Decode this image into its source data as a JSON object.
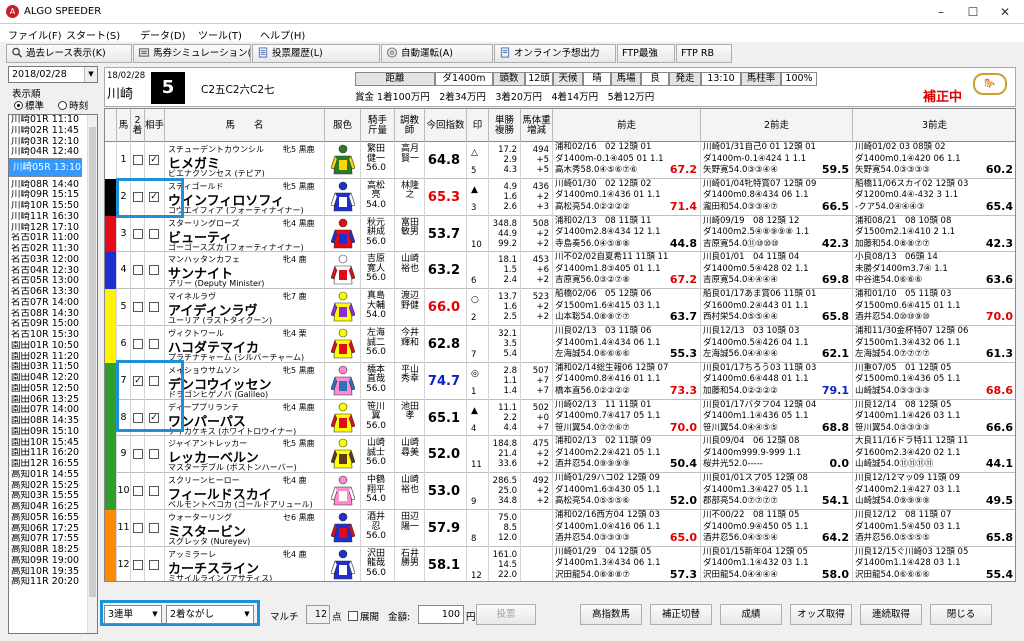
{
  "app": {
    "title": "ALGO SPEEDER",
    "icon": "algo-logo-icon"
  },
  "window": {
    "minimize": "–",
    "maximize": "☐",
    "close": "✕"
  },
  "menu": [
    "ファイル(F)",
    "スタート(S)",
    "データ(D)",
    "ツール(T)",
    "ヘルプ(H)"
  ],
  "toolbar": [
    {
      "label": "過去レース表示(K)",
      "icon": "search-icon"
    },
    {
      "label": "馬券シミュレーション(B)",
      "icon": "ticket-icon"
    },
    {
      "label": "投票履歴(L)",
      "icon": "document-icon"
    },
    {
      "label": "自動運転(A)",
      "icon": "disc-icon"
    },
    {
      "label": "オンライン予想出力",
      "icon": "document-icon"
    },
    {
      "label": "FTP最強",
      "icon": ""
    },
    {
      "label": "FTP RB",
      "icon": ""
    }
  ],
  "left": {
    "date": "2018/02/28",
    "order_label": "表示順",
    "order_opts": [
      "標準",
      "時刻"
    ],
    "races": [
      "川崎01R 11:10",
      "川崎02R 11:45",
      "川崎03R 12:10",
      "川崎04R 12:40",
      "川崎05R 13:10",
      "川崎06R 13:40",
      "川崎07R 14:10",
      "川崎08R 14:40",
      "川崎09R 15:15",
      "川崎10R 15:50",
      "川崎11R 16:30",
      "川崎12R 17:10",
      "名古01R 11:00",
      "名古02R 11:30",
      "名古03R 12:00",
      "名古04R 12:30",
      "名古05R 13:00",
      "名古06R 13:30",
      "名古07R 14:00",
      "名古08R 14:30",
      "名古09R 15:00",
      "名古10R 15:30",
      "園田01R 10:50",
      "園田02R 11:20",
      "園田03R 11:50",
      "園田04R 12:20",
      "園田05R 12:50",
      "園田06R 13:25",
      "園田07R 14:00",
      "園田08R 14:35",
      "園田09R 15:10",
      "園田10R 15:45",
      "園田11R 16:20",
      "園田12R 16:55",
      "高知01R 14:55",
      "高知02R 15:25",
      "高知03R 15:55",
      "高知04R 16:25",
      "高知05R 16:55",
      "高知06R 17:25",
      "高知07R 17:55",
      "高知08R 18:25",
      "高知09R 19:00",
      "高知10R 19:35",
      "高知11R 20:20"
    ],
    "selected": 4
  },
  "race": {
    "date": "18/02/28",
    "venue": "川崎",
    "number": "5",
    "class": "C2五C2六C2七",
    "dist_lbl": "距離",
    "dist": "ダ1400m",
    "count_lbl": "頭数",
    "count": "12頭",
    "weather_lbl": "天候",
    "weather": "晴",
    "track_lbl": "馬場",
    "track": "良",
    "post_lbl": "発走",
    "post": "13:10",
    "rate_lbl": "馬柱率",
    "rate": "100%",
    "prize": "賞金 1着100万円　2着34万円　3着20万円　4着14万円　5着12万円",
    "correction": "補正中"
  },
  "headers": [
    "馬",
    "2着",
    "相手",
    "馬　　名",
    "服色",
    "騎手\n斤量",
    "調教\n師",
    "今回指数",
    "印",
    "単勝\n複勝",
    "馬体重\n増減",
    "前走",
    "2前走",
    "3前走"
  ],
  "frame_colors": [
    "#ffffff",
    "#000000",
    "#e30b16",
    "#1e2fd0",
    "#fff200",
    "#2e9e2e",
    "#2e9e2e",
    "#ff8c00",
    "#ff8c00",
    "#ff8cd0",
    "#ff8cd0"
  ],
  "horses": [
    {
      "no": "1",
      "frame": "1",
      "c2": false,
      "opp": true,
      "sire": "スチューデントカウンシル",
      "sex": "牝5 黒鹿",
      "name": "ヒメガミ",
      "dam": "ビエナクソンセス (テピア)",
      "silk": [
        "#2a7a2a",
        "#ffd700"
      ],
      "jockey": "繁田\n健一\n56.0",
      "trainer": "高月\n賢一",
      "index": "64.8",
      "idx_color": "",
      "mark": "△",
      "mark_n": "5",
      "odds": "17.2\n2.9\n4.3",
      "weight": "494\n+5\n+5",
      "p1": [
        "浦和02/16　02 12頭 01",
        "ダ1400m-0.1④405 01 1.1",
        "高木秀58.0④⑤⑥⑦⑥ 67.2"
      ],
      "p1i": "67.2",
      "p1red": true,
      "p2": [
        "川崎01/31自己0 01 12頭 01",
        "ダ1400m-0.1④424 1 1.1",
        "矢野寛54.0③③④④ 59.5"
      ],
      "p2i": "59.5",
      "p3": [
        "川崎01/02 03 08頭 02",
        "ダ1400m0.1④420 06 1.1",
        "矢野寛54.0③③③③ 60.2"
      ],
      "p3i": "60.2"
    },
    {
      "no": "2",
      "frame": "2",
      "c2": false,
      "opp": true,
      "sire": "スティゴールド",
      "sex": "牝5 黒鹿",
      "name": "ウインフィロソフィ",
      "dam": "コウエイフィア (フォーティナイナー)",
      "silk": [
        "#1e2fd0",
        "#ffffff"
      ],
      "jockey": "高松\n亮\n54.0",
      "trainer": "林隆\n之",
      "index": "65.3",
      "idx_color": "red",
      "mark": "▲",
      "mark_n": "3",
      "odds": "4.9\n1.6\n2.6",
      "weight": "436\n+2\n+3",
      "p1": [
        "川崎01/30　02 12頭 02",
        "ダ1400m0.1④436 01 1.1",
        "高松亮54.0②②②② 71.4"
      ],
      "p1i": "71.4",
      "p1red": true,
      "p2": [
        "川崎01/04牝特賞07 12頭 09",
        "ダ1400m0.8④434 06 1.1",
        "瀧田和54.0③③④⑦ 66.5"
      ],
      "p2i": "66.5",
      "p3": [
        "船橋11/06スカイ02 12頭 03",
        "ダ1200m0.4④-432 3 1.1",
        "-クア54.0④④④③ 65.4"
      ],
      "p3i": "65.4"
    },
    {
      "no": "3",
      "frame": "3",
      "c2": false,
      "opp": false,
      "sire": "スターリングローズ",
      "sex": "牝4 黒鹿",
      "name": "ビューティ",
      "dam": "ゴーゴースズカ (フォーティナイナー)",
      "silk": [
        "#e30b16",
        "#1e2fd0"
      ],
      "jockey": "秋元\n耕成\n56.0",
      "trainer": "富田\n敏男",
      "index": "53.7",
      "idx_color": "",
      "mark": "",
      "mark_n": "10",
      "odds": "348.8\n44.9\n99.2",
      "weight": "508\n+2\n+2",
      "p1": [
        "浦和02/13　08 11頭 11",
        "ダ1400m2.8④434 12 1.1",
        "寺島奏56.0④⑤⑧⑧ 44.8"
      ],
      "p1i": "44.8",
      "p2": [
        "川崎09/19　08 12頭 12",
        "ダ1400m2.5④⑧⑨⑨⑧ 1.1",
        "吉原寛54.0⑪⑩⑩⑩ 42.3"
      ],
      "p2i": "42.3",
      "p3": [
        "浦和08/21　08 10頭 08",
        "ダ1500m2.1④410 2 1.1",
        "加藤和54.0⑧⑧⑦⑦ 42.3"
      ],
      "p3i": "42.3"
    },
    {
      "no": "4",
      "frame": "4",
      "c2": false,
      "opp": false,
      "sire": "マンハッタンカフェ",
      "sex": "牝4 鹿",
      "name": "サンナイト",
      "dam": "アリー (Deputy Minister)",
      "silk": [
        "#ffffff",
        "#e30b16"
      ],
      "jockey": "吉原\n寛人\n56.0",
      "trainer": "山崎\n裕也",
      "index": "63.2",
      "idx_color": "",
      "mark": "",
      "mark_n": "6",
      "odds": "18.1\n1.5\n2.4",
      "weight": "453\n+6\n+2",
      "p1": [
        "川不02/02自夏希11 11頭 11",
        "ダ1400m1.8③405 01 1.1",
        "吉原寛56.0③②⑦⑧ 67.2"
      ],
      "p1i": "67.2",
      "p1red": true,
      "p2": [
        "川良01/01　04 11頭 04",
        "ダ1400m0.5④428 02 1.1",
        "吉原寛54.0④④④④ 69.8"
      ],
      "p2i": "69.8",
      "p3": [
        "小良08/13　06頭 14",
        "未勝ダ1400m3.7④ 1.1",
        "中谷進54.0⑥⑥⑥ 63.6"
      ],
      "p3i": "63.6"
    },
    {
      "no": "5",
      "frame": "5",
      "c2": false,
      "opp": false,
      "sire": "マイネルラヴ",
      "sex": "牝7 鹿",
      "name": "アイディンラヴ",
      "dam": "ユーリア (ラストタイクーン)",
      "silk": [
        "#ffff00",
        "#8a2be2"
      ],
      "jockey": "真島\n大輔\n54.0",
      "trainer": "渡辺\n野健",
      "index": "66.0",
      "idx_color": "red",
      "mark": "○",
      "mark_n": "2",
      "odds": "13.7\n1.6\n2.5",
      "weight": "523\n+2\n+2",
      "p1": [
        "船橋02/06　05 12頭 06",
        "ダ1500m1.6④415 03 1.1",
        "山本聡54.0⑧⑧⑦⑦ 63.7"
      ],
      "p1i": "63.7",
      "p2": [
        "船良01/17あま賞06 11頭 01",
        "ダ1600m0.2④443 01 1.1",
        "西村栄54.0⑤⑤④④ 65.8"
      ],
      "p2i": "65.8",
      "p3": [
        "浦和01/10　05 11頭 03",
        "ダ1500m0.6④415 01 1.1",
        "酒井忍54.0⑩⑩⑨⑩ 70.0"
      ],
      "p3i": "70.0",
      "p3red": true
    },
    {
      "no": "6",
      "frame": "5",
      "c2": false,
      "opp": false,
      "sire": "ヴィクトワール",
      "sex": "牝4 栗",
      "name": "ハコダテマイカ",
      "dam": "プラチナチャーム (シルバーチャーム)",
      "silk": [
        "#ffff00",
        "#e30b16"
      ],
      "jockey": "左海\n誠二\n56.0",
      "trainer": "今井\n輝和",
      "index": "62.8",
      "idx_color": "",
      "mark": "",
      "mark_n": "7",
      "odds": "32.1\n3.5\n5.4",
      "weight": "",
      "p1": [
        "川良02/13　03 11頭 06",
        "ダ1400m1.4④434 06 1.1",
        "左海誠54.0⑥⑥⑥⑥ 55.3"
      ],
      "p1i": "55.3",
      "p2": [
        "川良12/13　03 10頭 03",
        "ダ1400m0.5④426 04 1.1",
        "左海誠56.0④④④④ 62.1"
      ],
      "p2i": "62.1",
      "p3": [
        "浦和11/30金杯特07 12頭 06",
        "ダ1500m1.3④432 06 1.1",
        "左海誠54.0⑦⑦⑦⑦ 61.3"
      ],
      "p3i": "61.3"
    },
    {
      "no": "7",
      "frame": "6",
      "c2": true,
      "opp": false,
      "sire": "メイショウサムソン",
      "sex": "牝5 黒鹿",
      "name": "デンコウイッセン",
      "dam": "ドラゴンヒゲノバ (Galileo)",
      "silk": [
        "#ff8cd0",
        "#3070c0"
      ],
      "jockey": "橋本\n直哉\n56.0",
      "trainer": "平山\n秀幸",
      "index": "74.7",
      "idx_color": "blue",
      "mark": "◎",
      "mark_n": "1",
      "odds": "2.8\n1.1\n1.4",
      "weight": "507\n+7\n+7",
      "p1": [
        "浦和02/14総生報06 12頭 07",
        "ダ1400m0.8④416 01 1.1",
        "橋本直56.0②②②② 73.3"
      ],
      "p1i": "73.3",
      "p1red": true,
      "p2": [
        "川良01/17ちろう03 11頭 03",
        "ダ1400m0.6④448 01 1.1",
        "加藤和54.0②②②② 79.1"
      ],
      "p2i": "79.1",
      "p2blue": true,
      "p3": [
        "川重07/05　01 12頭 05",
        "ダ1500m0.1④436 05 1.1",
        "山崎誠54.0③③③③ 68.6"
      ],
      "p3i": "68.6",
      "p3red": true
    },
    {
      "no": "8",
      "frame": "6",
      "c2": false,
      "opp": true,
      "sire": "ディープブリランテ",
      "sex": "牝4 黒鹿",
      "name": "ワンパーパス",
      "dam": "ケイカケキス (ホワイトロウイナー)",
      "silk": [
        "#ffff00",
        "#e30b16"
      ],
      "jockey": "笹川\n翼\n56.0",
      "trainer": "池田\n孝",
      "index": "65.1",
      "idx_color": "",
      "mark": "▲",
      "mark_n": "4",
      "odds": "11.1\n2.2\n4.4",
      "weight": "502\n+0\n+7",
      "p1": [
        "川崎02/13　11 11頭 01",
        "ダ1400m0.7④417 05 1.1",
        "笹川翼54.0⑦⑦⑥⑦ 70.0"
      ],
      "p1i": "70.0",
      "p1red": true,
      "p2": [
        "川良01/17バタフ04 12頭 04",
        "ダ1400m1.1④436 05 1.1",
        "笹川翼54.0④④⑤⑤ 68.8"
      ],
      "p2i": "68.8",
      "p3": [
        "川良12/14　08 12頭 05",
        "ダ1400m1.1④426 03 1.1",
        "笹川翼54.0③③③③ 66.6"
      ],
      "p3i": "66.6"
    },
    {
      "no": "9",
      "frame": "7",
      "c2": false,
      "opp": false,
      "sire": "ジャイアントレッカー",
      "sex": "牝5 黒鹿",
      "name": "レッカーベルン",
      "dam": "マスターデブル (ボストンハーバー)",
      "silk": [
        "#ffff00",
        "#5a3a1a"
      ],
      "jockey": "山崎\n誠士\n56.0",
      "trainer": "山崎\n尋美",
      "index": "52.0",
      "idx_color": "",
      "mark": "",
      "mark_n": "11",
      "odds": "184.8\n21.4\n33.6",
      "weight": "475\n+2\n+2",
      "p1": [
        "浦和02/13　02 11頭 09",
        "ダ1400m2.2④421 05 1.1",
        "酒井忍54.0⑨⑨⑨⑨ 50.4"
      ],
      "p1i": "50.4",
      "p2": [
        "川良09/04　06 12頭 08",
        "ダ1400m999.9-999 1.1",
        "桜井光52.0----- 0.0"
      ],
      "p2i": "0.0",
      "p3": [
        "大良11/16ドラ特11 12頭 11",
        "ダ1600m2.3④420 02 1.1",
        "山崎誠54.0⑪⑪⑪⑪ 44.1"
      ],
      "p3i": "44.1"
    },
    {
      "no": "10",
      "frame": "7",
      "c2": false,
      "opp": false,
      "sire": "スクリーンヒーロー",
      "sex": "牝4 鹿",
      "name": "フィールドスカイ",
      "dam": "ベルモントペコカ (ゴールドアリュール)",
      "silk": [
        "#ff8cd0",
        "#ffffff"
      ],
      "jockey": "中鶴\n翔平\n54.0",
      "trainer": "山崎\n裕也",
      "index": "53.0",
      "idx_color": "",
      "mark": "",
      "mark_n": "9",
      "odds": "286.5\n25.0\n34.8",
      "weight": "492\n+2\n+2",
      "p1": [
        "川崎01/29ハコ02 12頭 09",
        "ダ1400m1.6③430 05 1.1",
        "高松亮54.0⑤⑤⑤⑥ 52.0"
      ],
      "p1i": "52.0",
      "p2": [
        "川良01/01スプ05 12頭 08",
        "ダ1400m1.3④427 05 1.1",
        "郡部亮54.0⑦⑦⑦⑦ 54.1"
      ],
      "p2i": "54.1",
      "p3": [
        "川良12/12マッ09 11頭 09",
        "ダ1400m2.1④427 03 1.1",
        "山崎誠54.0⑨⑨⑨⑨ 49.5"
      ],
      "p3i": "49.5"
    },
    {
      "no": "11",
      "frame": "8",
      "c2": false,
      "opp": false,
      "sire": "ウォーターリング",
      "sex": "セ6 黒鹿",
      "name": "ミスタービン",
      "dam": "スグレッタ (Nureyev)",
      "silk": [
        "#1e2fd0",
        "#e30b16"
      ],
      "jockey": "酒井\n忍\n56.0",
      "trainer": "田辺\n陽一",
      "index": "57.9",
      "idx_color": "",
      "mark": "",
      "mark_n": "8",
      "odds": "75.0\n8.5\n12.0",
      "weight": "",
      "p1": [
        "浦和02/16西方04 12頭 03",
        "ダ1400m1.0④416 06 1.1",
        "酒井忍54.0③③③③ 65.0"
      ],
      "p1i": "65.0",
      "p1red": true,
      "p2": [
        "川不00/22　08 11頭 05",
        "ダ1400m0.9④450 05 1.1",
        "酒井忍56.0④⑤⑤④ 64.2"
      ],
      "p2i": "64.2",
      "p3": [
        "川良12/12　08 11頭 07",
        "ダ1400m1.5④450 03 1.1",
        "酒井忍56.0⑤⑤⑤⑤ 65.8"
      ],
      "p3i": "65.8"
    },
    {
      "no": "12",
      "frame": "8",
      "c2": false,
      "opp": false,
      "sire": "アッミラーレ",
      "sex": "牝4 鹿",
      "name": "カーチスライン",
      "dam": "ミサイルライン (アサティス)",
      "silk": [
        "#1e2fd0",
        "#ffffff"
      ],
      "jockey": "沢田\n龍哉\n56.0",
      "trainer": "石井\n勝男",
      "index": "58.1",
      "idx_color": "",
      "mark": "",
      "mark_n": "12",
      "odds": "161.0\n14.5\n22.0",
      "weight": "",
      "p1": [
        "川崎01/29　04 12頭 05",
        "ダ1400m1.3④434 06 1.1",
        "沢田龍54.0⑧⑧⑧⑦ 57.3"
      ],
      "p1i": "57.3",
      "p2": [
        "川良01/15新年04 12頭 05",
        "ダ1400m1.1④432 03 1.1",
        "沢田龍54.0④④④④ 58.0"
      ],
      "p2i": "58.0",
      "p3": [
        "川良12/15ぐ川崎03 12頭 05",
        "ダ1400m1.1④428 03 1.1",
        "沢田龍54.0⑥⑥⑥⑥ 55.4"
      ],
      "p3i": "55.4"
    }
  ],
  "bottom": {
    "bet_type": "3連単",
    "bet_mode": "2着ながし",
    "multi": "マルチ",
    "points": "12",
    "points_unit": "点",
    "expand": "展開",
    "amount_lbl": "金額:",
    "amount": "100",
    "amount_unit": "円",
    "vote": "投票",
    "buttons": [
      "高指数馬",
      "補正切替",
      "成績",
      "オッズ取得",
      "連続取得",
      "閉じる"
    ]
  }
}
